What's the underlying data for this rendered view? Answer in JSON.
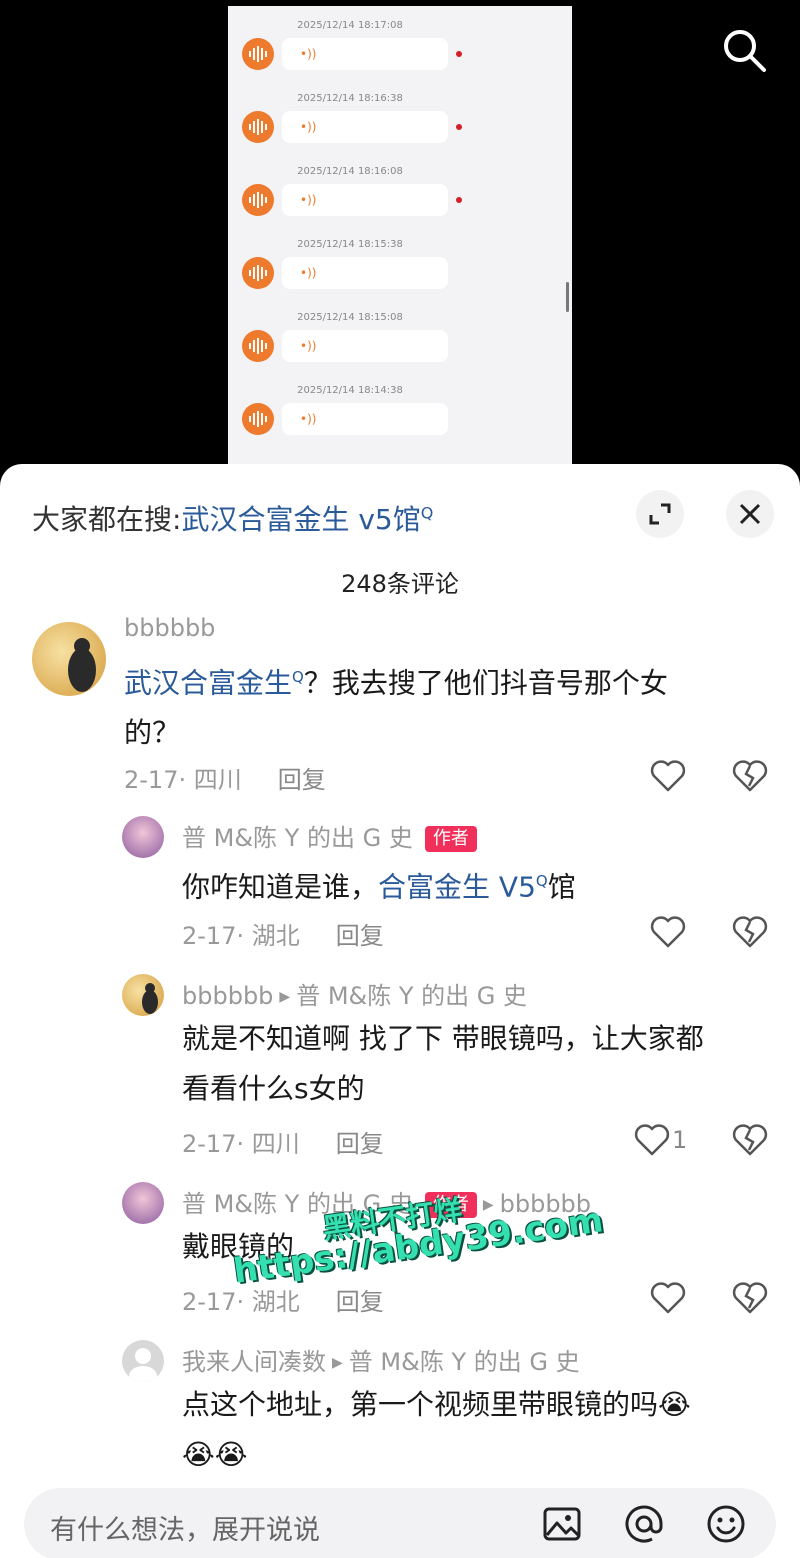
{
  "video": {
    "voice_messages": [
      {
        "timestamp": "2025/12/14 18:17:08",
        "unread": true
      },
      {
        "timestamp": "2025/12/14 18:16:38",
        "unread": true
      },
      {
        "timestamp": "2025/12/14 18:16:08",
        "unread": true
      },
      {
        "timestamp": "2025/12/14 18:15:38",
        "unread": false
      },
      {
        "timestamp": "2025/12/14 18:15:08",
        "unread": false
      },
      {
        "timestamp": "2025/12/14 18:14:38",
        "unread": false
      }
    ],
    "voice_glyph": "•))",
    "icons": {
      "search": "search-icon",
      "voice_avatar": "soundwave-icon"
    }
  },
  "hot_search": {
    "prefix": "大家都在搜:",
    "keyword": "武汉合富金生 v5馆",
    "search_mark": "Q"
  },
  "comments_count": "248条评论",
  "comments": [
    {
      "username": "bbbbbb",
      "text_keyword": "武汉合富金生",
      "text_line1_rest": "？我去搜了他们抖音号那个女",
      "text_line2": "的？",
      "meta": "2-17· 四川",
      "reply": "回复"
    },
    {
      "username": "普 M&陈 Y 的出 G 史",
      "author_tag": "作者",
      "text_prefix": "你咋知道是谁，",
      "text_keyword": "合富金生 V5",
      "text_suffix": "馆",
      "meta": "2-17· 湖北",
      "reply": "回复"
    },
    {
      "username": "bbbbbb",
      "reply_to": "普 M&陈 Y 的出 G 史",
      "text_line1": "就是不知道啊 找了下 带眼镜吗，让大家都",
      "text_line2": "看看什么s女的",
      "meta": "2-17· 四川",
      "reply": "回复",
      "likes": "1"
    },
    {
      "username": "普 M&陈 Y 的出 G 史",
      "author_tag": "作者",
      "reply_to": "bbbbbb",
      "text_line1": "戴眼镜的",
      "meta": "2-17· 湖北",
      "reply": "回复"
    },
    {
      "username": "我来人间凑数",
      "reply_to": "普 M&陈 Y 的出 G 史",
      "text_line1": "点这个地址，第一个视频里带眼镜的吗😭",
      "text_line2": "😭😭"
    }
  ],
  "watermark": {
    "line1": "黑料不打烊",
    "line2": "https://abdy39.com"
  },
  "input": {
    "placeholder": "有什么想法，展开说说"
  },
  "colors": {
    "author_tag": "#f0305a",
    "keyword_link": "#2b5a9a",
    "voice_accent": "#ee7a2d",
    "watermark": "#35e0b0"
  }
}
